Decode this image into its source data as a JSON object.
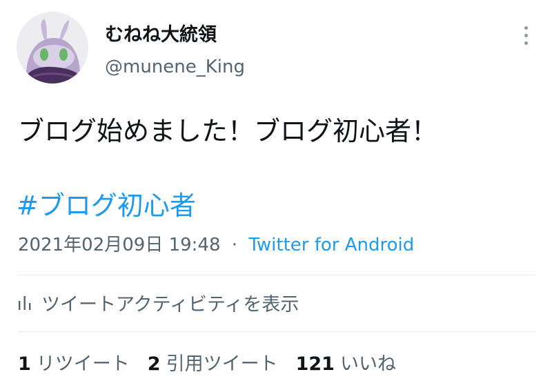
{
  "tweet": {
    "author": {
      "display_name": "むねね大統領",
      "handle": "@munene_King"
    },
    "text": "ブログ始めました！ブログ初心者！",
    "hashtag": "#ブログ初心者",
    "timestamp": "2021年02月09日 19:48",
    "separator": "·",
    "source": "Twitter for Android",
    "activity_label": "ツイートアクティビティを表示",
    "stats": [
      {
        "count": "1",
        "label": "リツイート"
      },
      {
        "count": "2",
        "label": "引用ツイート"
      },
      {
        "count": "121",
        "label": "いいね"
      }
    ]
  },
  "colors": {
    "link": "#1d9bf0",
    "muted": "#536471",
    "text": "#0f1419",
    "divider": "#e6ecf0"
  },
  "icons": {
    "more": "vertical-ellipsis-icon",
    "activity": "bar-chart-icon"
  }
}
